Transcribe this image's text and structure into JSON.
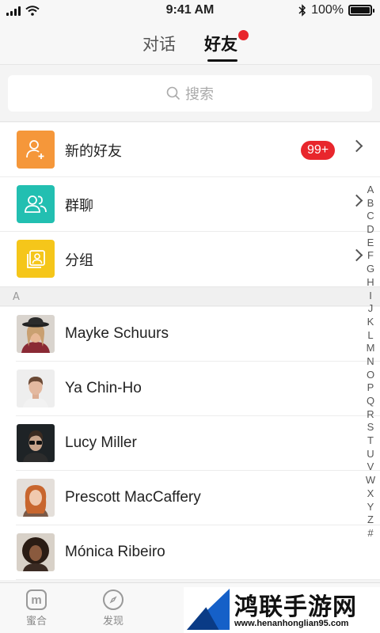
{
  "status_bar": {
    "time": "9:41 AM",
    "battery": "100%"
  },
  "header": {
    "tabs": [
      {
        "label": "对话"
      },
      {
        "label": "好友",
        "active": true
      }
    ]
  },
  "search": {
    "placeholder": "搜索"
  },
  "menu": [
    {
      "label": "新的好友",
      "badge": "99+",
      "icon": "add-user-icon",
      "color": "#f5973a"
    },
    {
      "label": "群聊",
      "icon": "group-icon",
      "color": "#22bfb1"
    },
    {
      "label": "分组",
      "icon": "folder-icon",
      "color": "#f5c61a"
    }
  ],
  "section_letter": "A",
  "contacts": [
    {
      "name": "Mayke Schuurs"
    },
    {
      "name": "Ya Chin-Ho"
    },
    {
      "name": "Lucy Miller"
    },
    {
      "name": "Prescott MacCaffery"
    },
    {
      "name": "Mónica Ribeiro"
    }
  ],
  "index_letters": [
    "A",
    "B",
    "C",
    "D",
    "E",
    "F",
    "G",
    "H",
    "I",
    "J",
    "K",
    "L",
    "M",
    "N",
    "O",
    "P",
    "Q",
    "R",
    "S",
    "T",
    "U",
    "V",
    "W",
    "X",
    "Y",
    "Z",
    "#"
  ],
  "bottom_nav": {
    "home_label": "蜜合",
    "discover_label": "发现"
  },
  "watermark": {
    "title": "鸿联手游网",
    "url": "www.henanhonglian95.com"
  }
}
